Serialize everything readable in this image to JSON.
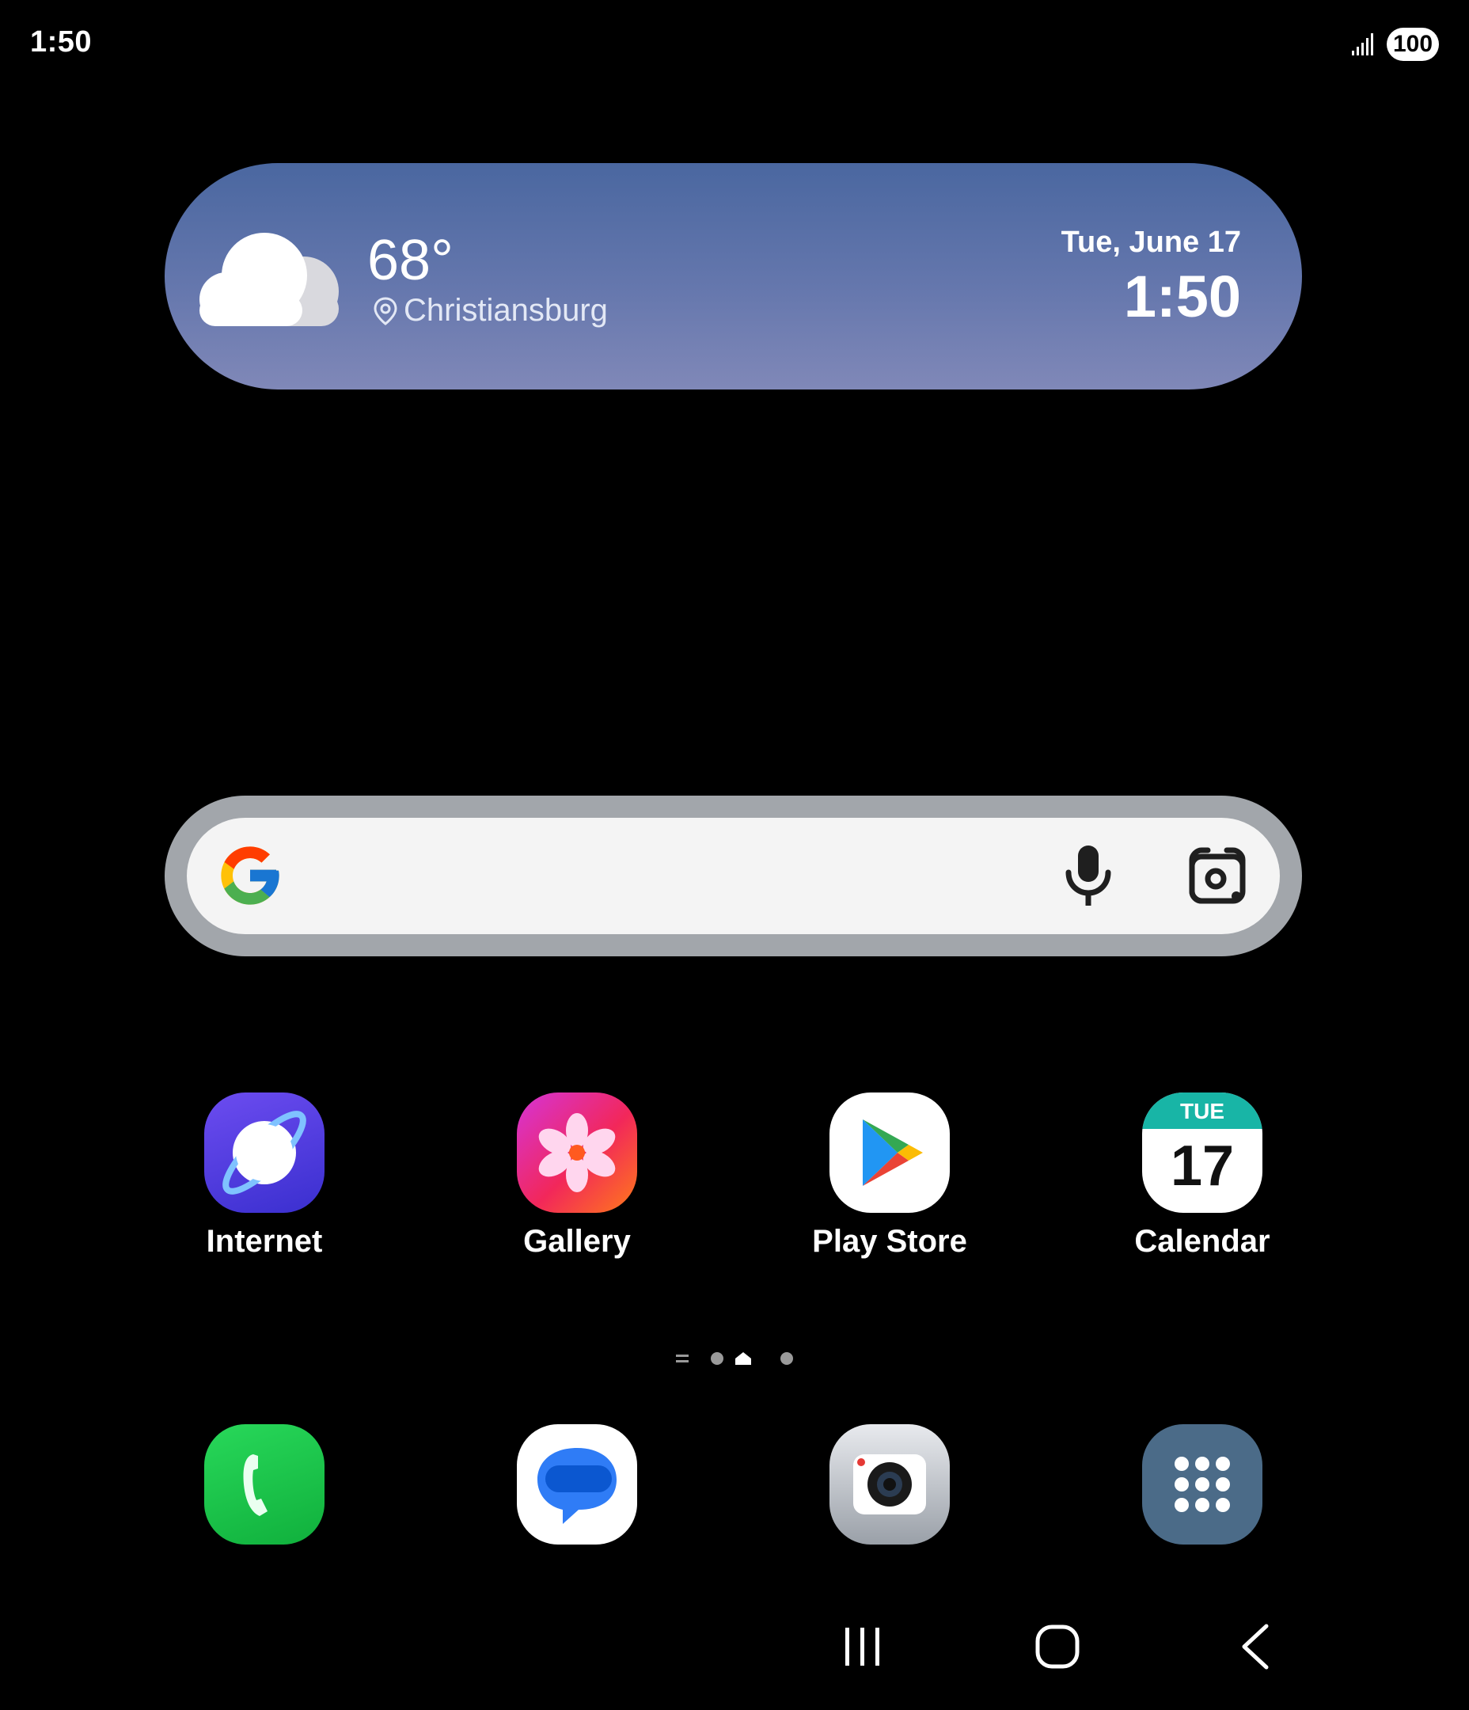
{
  "status_bar": {
    "time": "1:50",
    "battery": "100"
  },
  "weather_widget": {
    "temperature": "68°",
    "location": "Christiansburg",
    "date": "Tue, June 17",
    "time": "1:50"
  },
  "home_apps": [
    {
      "label": "Internet"
    },
    {
      "label": "Gallery"
    },
    {
      "label": "Play Store"
    },
    {
      "label": "Calendar"
    }
  ],
  "calendar_icon": {
    "day": "TUE",
    "date": "17"
  },
  "colors": {
    "background": "#000000",
    "weather_gradient_top": "#4a67a0",
    "weather_gradient_bottom": "#8088b8",
    "search_frame": "#a2a6ab"
  }
}
